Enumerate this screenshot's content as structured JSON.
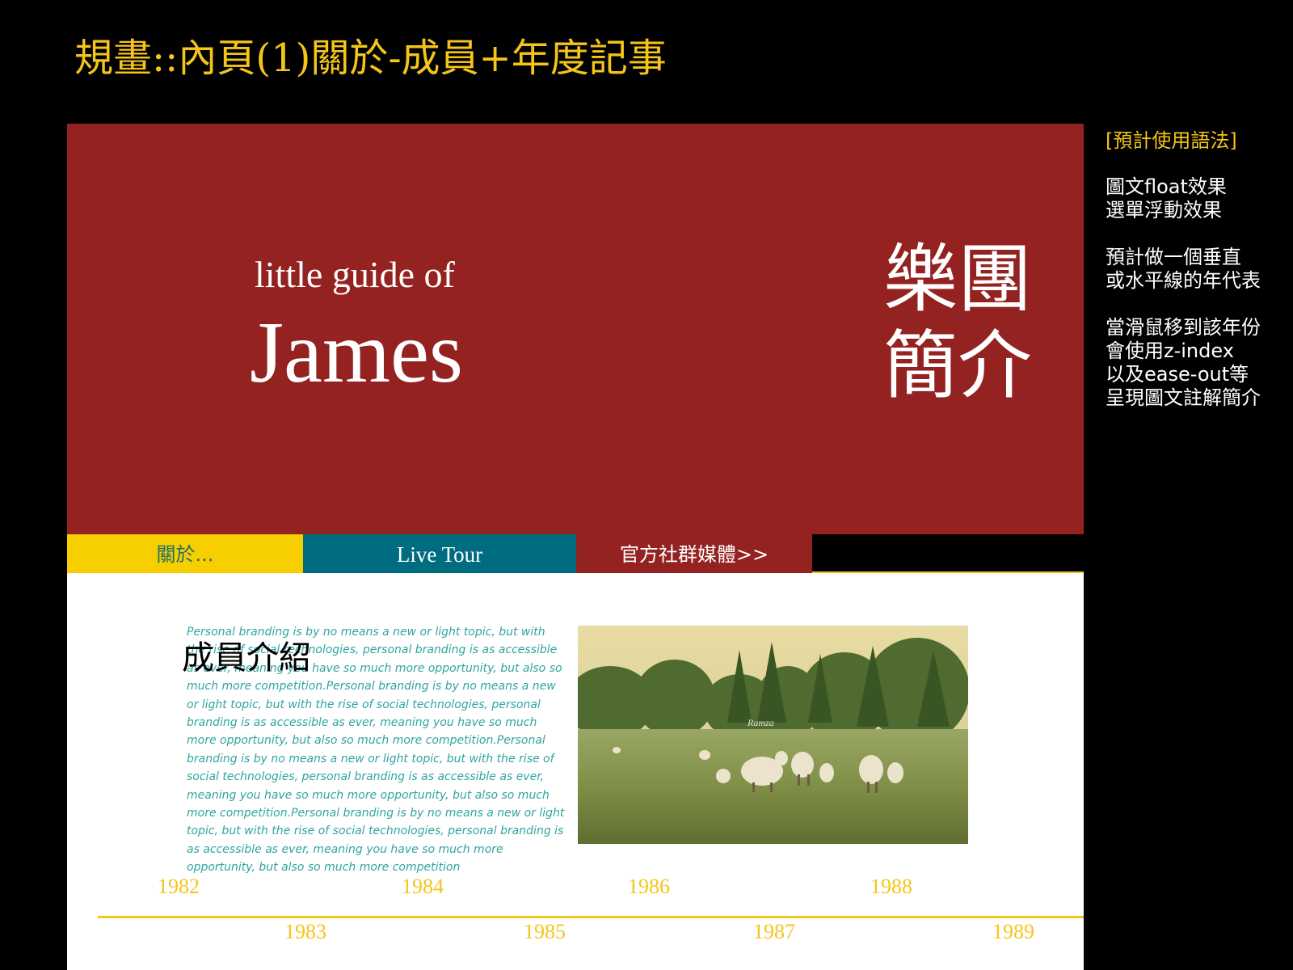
{
  "slide": {
    "title": "規畫::內頁(1)關於-成員+年度記事"
  },
  "hero": {
    "subtitle": "little guide of",
    "name": "James",
    "intro_line1": "樂團",
    "intro_line2": "簡介"
  },
  "nav": {
    "about": "關於...",
    "tour": "Live Tour",
    "social": "官方社群媒體>>"
  },
  "content": {
    "heading": "成員介紹",
    "paragraph": "Personal branding is by no means a new or light topic, but with the rise of social technologies, personal branding is as accessible as ever, meaning you have so much more opportunity, but also so much more competition.Personal branding is by no means a new or light topic, but with the rise of social technologies, personal branding is as accessible as ever, meaning you have so much more opportunity, but also so much more competition.Personal branding is by no means a new or light topic, but with the rise of social technologies, personal branding is as accessible as ever, meaning you have so much more opportunity, but also so much more competition.Personal branding is by no means a new or light topic, but with the rise of social technologies, personal branding is as accessible as ever, meaning you have so much more opportunity, but also so much more competition",
    "photo_watermark": "Ramza"
  },
  "timeline": {
    "top_years": [
      "1982",
      "1984",
      "1986",
      "1988"
    ],
    "bottom_years": [
      "1983",
      "1985",
      "1987",
      "1989"
    ]
  },
  "notes": {
    "header": "[預計使用語法]",
    "block1": [
      "圖文float效果",
      "選單浮動效果"
    ],
    "block2": [
      "預計做一個垂直",
      "或水平線的年代表"
    ],
    "block3": [
      "當滑鼠移到該年份",
      "會使用z-index",
      "以及ease-out等",
      "呈現圖文註解簡介"
    ]
  },
  "colors": {
    "accent_yellow": "#f5c518",
    "hero_red": "#932220",
    "nav_yellow": "#f7ce00",
    "nav_teal": "#006c80",
    "paragraph_teal": "#2fa59f"
  }
}
